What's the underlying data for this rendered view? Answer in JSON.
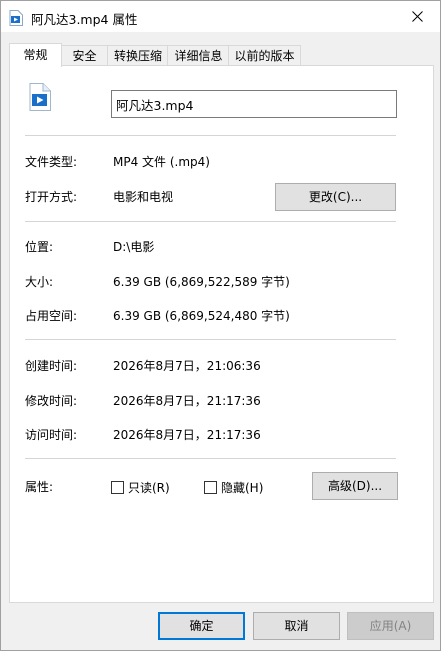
{
  "window": {
    "title": "阿凡达3.mp4 属性"
  },
  "tabs": [
    {
      "label": "常规"
    },
    {
      "label": "安全"
    },
    {
      "label": "转换压缩"
    },
    {
      "label": "详细信息"
    },
    {
      "label": "以前的版本"
    }
  ],
  "general": {
    "filename": "阿凡达3.mp4",
    "file_type_label": "文件类型:",
    "file_type_value": "MP4 文件 (.mp4)",
    "opens_with_label": "打开方式:",
    "opens_with_value": "电影和电视",
    "change_button": "更改(C)...",
    "location_label": "位置:",
    "location_value": "D:\\电影",
    "size_label": "大小:",
    "size_value": "6.39 GB (6,869,522,589 字节)",
    "size_on_disk_label": "占用空间:",
    "size_on_disk_value": "6.39 GB (6,869,524,480 字节)",
    "created_label": "创建时间:",
    "created_value": "2026年8月7日，21:06:36",
    "modified_label": "修改时间:",
    "modified_value": "2026年8月7日，21:17:36",
    "accessed_label": "访问时间:",
    "accessed_value": "2026年8月7日，21:17:36",
    "attributes_label": "属性:",
    "readonly_label": "只读(R)",
    "hidden_label": "隐藏(H)",
    "advanced_button": "高级(D)..."
  },
  "footer": {
    "ok": "确定",
    "cancel": "取消",
    "apply": "应用(A)"
  },
  "colors": {
    "accent": "#0078d7",
    "icon_blue": "#1a6fc9"
  }
}
